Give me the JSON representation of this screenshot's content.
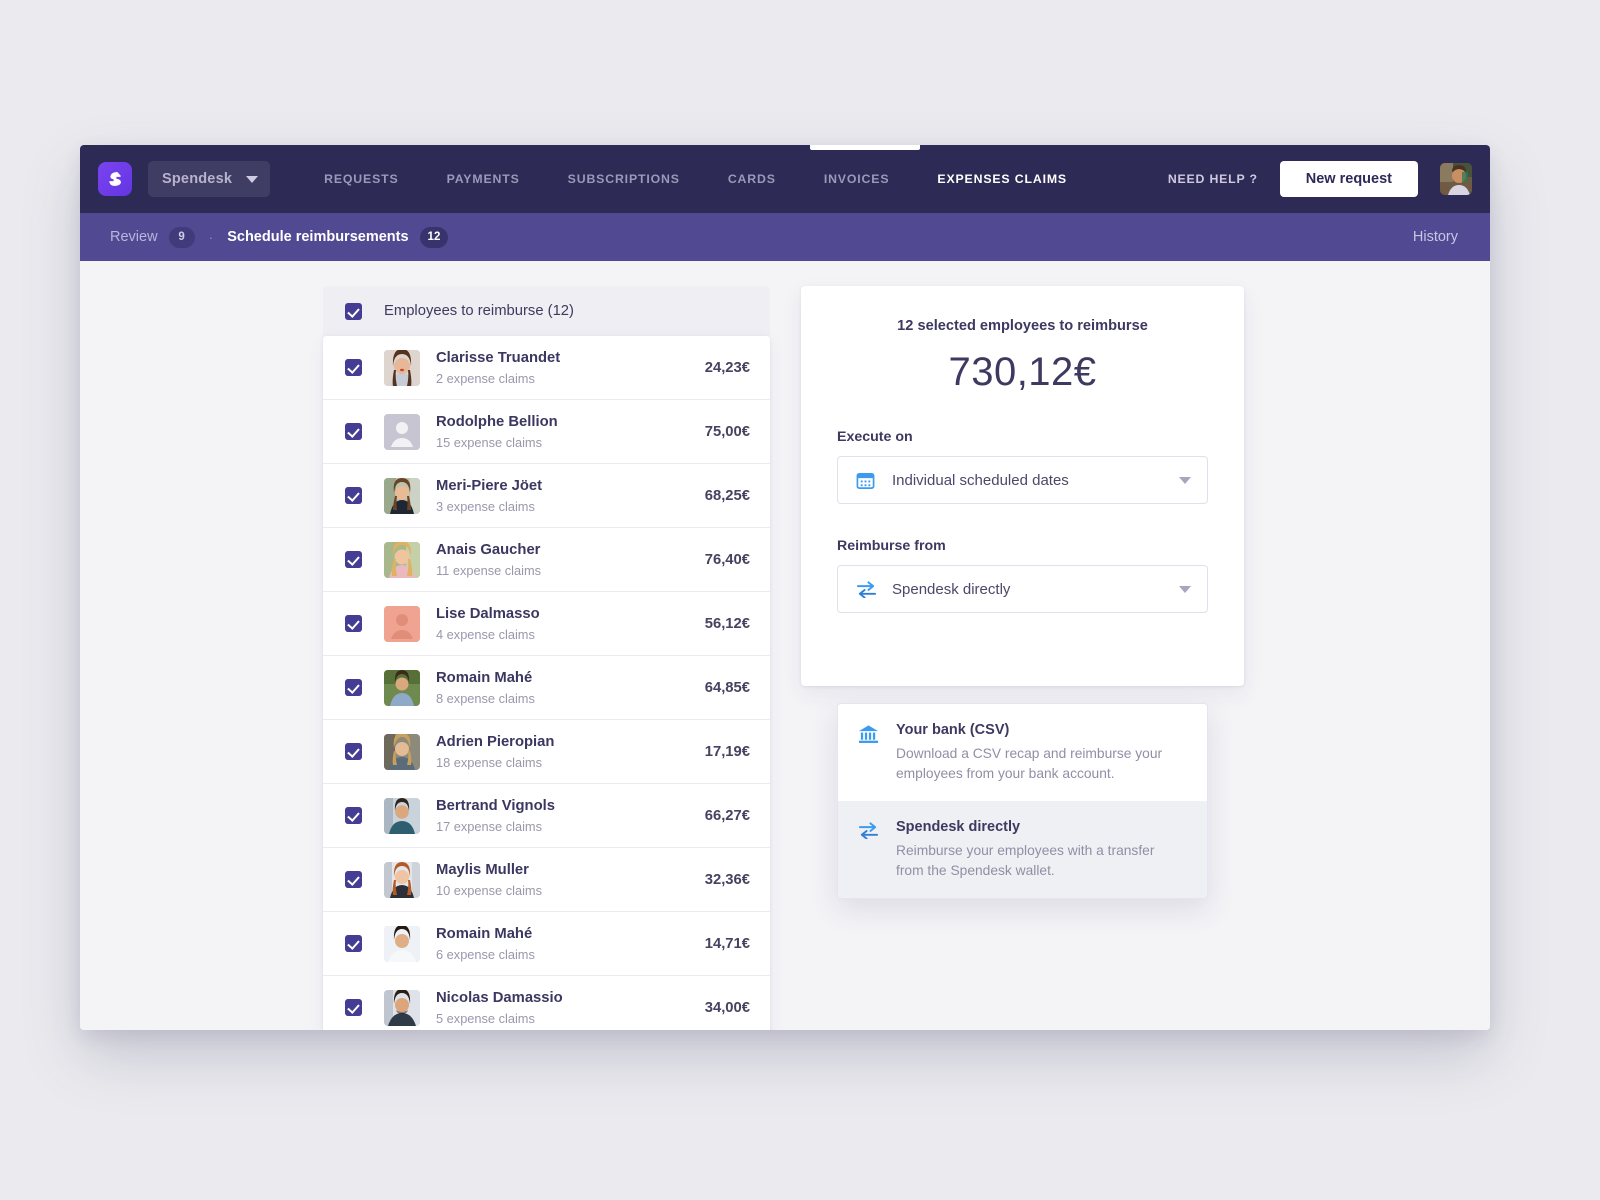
{
  "topnav": {
    "logo_icon": "spendesk-logo-icon",
    "org_name": "Spendesk",
    "links": [
      {
        "label": "REQUESTS",
        "active": false
      },
      {
        "label": "PAYMENTS",
        "active": false
      },
      {
        "label": "SUBSCRIPTIONS",
        "active": false
      },
      {
        "label": "CARDS",
        "active": false
      },
      {
        "label": "INVOICES",
        "active": false
      },
      {
        "label": "EXPENSES CLAIMS",
        "active": true
      }
    ],
    "need_help": "NEED HELP ?",
    "new_request": "New request"
  },
  "subheader": {
    "crumbs": [
      {
        "label": "Review",
        "badge": "9",
        "active": false
      },
      {
        "label": "Schedule reimbursements",
        "badge": "12",
        "active": true
      }
    ],
    "separator": "·",
    "history": "History"
  },
  "list": {
    "header_label": "Employees to reimburse (12)",
    "rows": [
      {
        "name": "Clarisse Truandet",
        "claims": "2 expense claims",
        "amount": "24,23€",
        "avatar": "photo-woman-brunette",
        "checked": true
      },
      {
        "name": "Rodolphe Bellion",
        "claims": "15 expense claims",
        "amount": "75,00€",
        "avatar": "placeholder-person-grey",
        "checked": true
      },
      {
        "name": "Meri-Piere Jöet",
        "claims": "3 expense claims",
        "amount": "68,25€",
        "avatar": "photo-woman-outdoors",
        "checked": true
      },
      {
        "name": "Anais Gaucher",
        "claims": "11 expense claims",
        "amount": "76,40€",
        "avatar": "photo-woman-blonde",
        "checked": true
      },
      {
        "name": "Lise Dalmasso",
        "claims": "4 expense claims",
        "amount": "56,12€",
        "avatar": "placeholder-person-salmon",
        "checked": true
      },
      {
        "name": "Romain Mahé",
        "claims": "8 expense claims",
        "amount": "64,85€",
        "avatar": "photo-man-green",
        "checked": true
      },
      {
        "name": "Adrien Pieropian",
        "claims": "18 expense claims",
        "amount": "17,19€",
        "avatar": "photo-man-blond",
        "checked": true
      },
      {
        "name": "Bertrand Vignols",
        "claims": "17 expense claims",
        "amount": "66,27€",
        "avatar": "photo-man-teal",
        "checked": true
      },
      {
        "name": "Maylis Muller",
        "claims": "10 expense claims",
        "amount": "32,36€",
        "avatar": "photo-woman-redhead",
        "checked": true
      },
      {
        "name": "Romain Mahé",
        "claims": "6 expense claims",
        "amount": "14,71€",
        "avatar": "photo-man-white-shirt",
        "checked": true
      },
      {
        "name": "Nicolas Damassio",
        "claims": "5 expense claims",
        "amount": "34,00€",
        "avatar": "photo-man-dark-sweater",
        "checked": true
      }
    ]
  },
  "summary": {
    "title": "12 selected employees to reimburse",
    "amount": "730,12€",
    "execute_on_label": "Execute on",
    "execute_on_value": "Individual scheduled dates",
    "execute_on_icon": "calendar-icon",
    "reimburse_from_label": "Reimburse from",
    "reimburse_from_value": "Spendesk directly",
    "reimburse_from_icon": "transfer-arrows-icon"
  },
  "reimburse_menu": {
    "options": [
      {
        "title": "Your bank (CSV)",
        "desc": "Download a CSV recap and reimburse your employees from your bank account.",
        "icon": "bank-icon",
        "highlighted": false
      },
      {
        "title": "Spendesk directly",
        "desc": "Reimburse your employees with a transfer from the Spendesk wallet.",
        "icon": "transfer-arrows-icon",
        "highlighted": true
      }
    ]
  },
  "colors": {
    "nav_bg": "#2e2a56",
    "subheader_bg": "#514a92",
    "brand_purple": "#6236e0",
    "checkbox": "#453c94",
    "accent_blue": "#3b9bf0",
    "page_bg": "#ebebef"
  }
}
